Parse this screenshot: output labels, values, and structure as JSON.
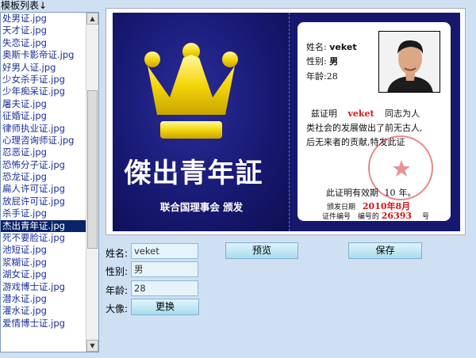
{
  "list": {
    "title": "模板列表↓",
    "items": [
      "处男证.jpg",
      "天才证.jpg",
      "失恋证.jpg",
      "奥斯卡影帝证.jpg",
      "好男人证.jpg",
      "少女杀手证.jpg",
      "少年痴呆证.jpg",
      "屠夫证.jpg",
      "征婚证.jpg",
      "律师执业证.jpg",
      "心理咨询师证.jpg",
      "忍恶证.jpg",
      "恐怖分子证.jpg",
      "恐龙证.jpg",
      "扁人许可证.jpg",
      "放屁许可证.jpg",
      "杀手证.jpg",
      "杰出青年证.jpg",
      "死不要脸证.jpg",
      "池短证.jpg",
      "浆糊证.jpg",
      "湖女证.jpg",
      "游戏博士证.jpg",
      "潜水证.jpg",
      "灌水证.jpg",
      "爱情博士证.jpg"
    ],
    "selected_index": 17,
    "scroll_up_icon": "triangle-up-icon",
    "scroll_down_icon": "triangle-down-icon"
  },
  "card": {
    "title": "傑出青年証",
    "issuer": "联合国理事会 颁发",
    "name_label": "姓名:",
    "name_value": "veket",
    "gender_label": "性别:",
    "gender_value": "男",
    "age_label": "年龄:",
    "age_value": "28",
    "cert_prefix": "兹证明",
    "cert_name": "veket",
    "cert_suffix": "同志为人",
    "cert_line2": "类社会的发展做出了前无古人,",
    "cert_line3": "后无来者的贡献,特发此证",
    "valid_text": "此证明有效期",
    "valid_years": "10",
    "valid_unit": "年。",
    "issue_label": "颁发日期",
    "issue_date": "2010年8月",
    "number_label": "证件编号",
    "number_label2": "编号的",
    "number_value": "26393",
    "number_suffix": "号",
    "stamp_text": "休闲娱乐证件中心",
    "crown_icon": "crown-icon",
    "colors": {
      "card_blue": "#16186e",
      "crown_gold": "#f5d60a",
      "stamp_red": "#d01818"
    }
  },
  "form": {
    "name_label": "姓名:",
    "name_value": "veket",
    "gender_label": "性别:",
    "gender_value": "男",
    "age_label": "年龄:",
    "age_value": "28",
    "avatar_label": "大像:",
    "change_button": "更换",
    "preview_button": "预览",
    "save_button": "保存"
  }
}
